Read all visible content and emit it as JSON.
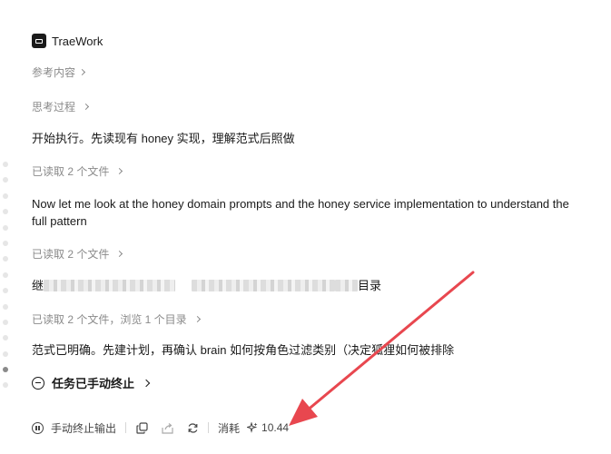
{
  "app": {
    "name": "TraeWork",
    "logo_icon": "trae-logo-icon"
  },
  "sections": {
    "reference": "参考内容",
    "thinking": "思考过程",
    "msg1": "开始执行。先读现有 honey 实现，理解范式后照做",
    "read1": "已读取 2 个文件",
    "msg2_line1": "Now let me look at the honey domain prompts and the honey service implementation to understand the",
    "msg2_line2": "full pattern",
    "read2": "已读取 2 个文件",
    "msg3_prefix": "继",
    "msg3_suffix": "目录",
    "read3": "已读取 2 个文件，浏览 1 个目录",
    "msg4": "范式已明确。先建计划，再确认 brain 如何按角色过滤类别（决定狐狸如何被排除",
    "stopped": "任务已手动终止"
  },
  "toolbar": {
    "stop_output": "手动终止输出",
    "consume_label": "消耗",
    "consume_value": "10.44",
    "icons": [
      "pause-icon",
      "copy-icon",
      "share-icon",
      "retry-icon",
      "sparkle-icon"
    ]
  },
  "colors": {
    "annotation_arrow": "#e8474f",
    "muted_text": "#8a8a8a",
    "body_text": "#1a1a1a"
  }
}
